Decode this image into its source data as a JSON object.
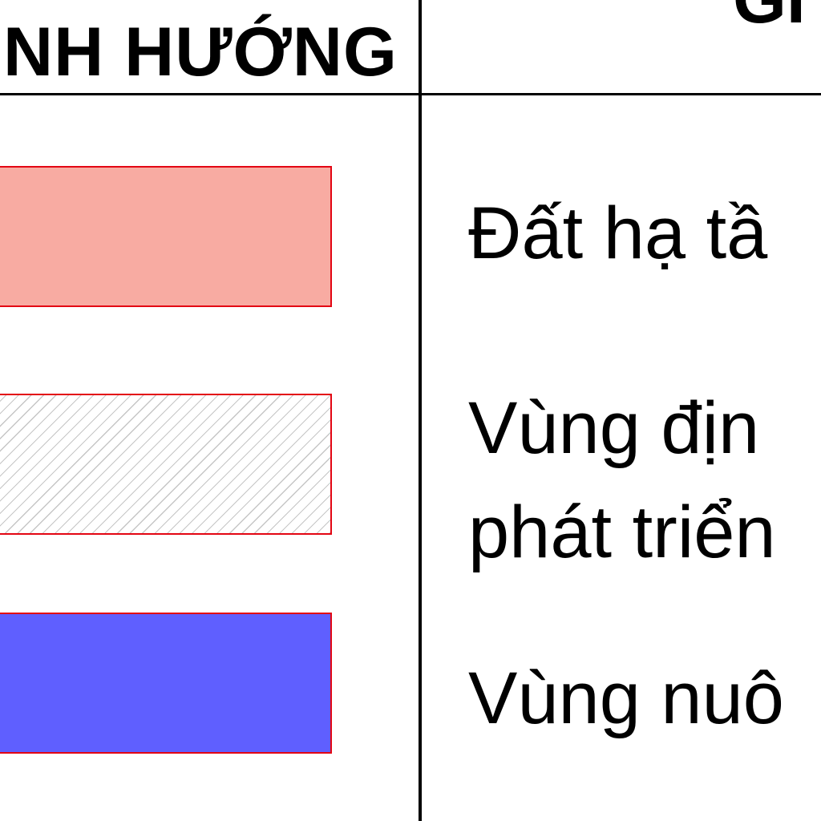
{
  "header": {
    "left_title": "NH HƯỚNG",
    "right_title": "GI"
  },
  "legend": {
    "items": [
      {
        "fill_color": "#f8aba2",
        "border_color": "#e30613",
        "pattern": "solid",
        "lines": [
          "Đất hạ tầ"
        ]
      },
      {
        "fill_color": "#ffffff",
        "border_color": "#e30613",
        "pattern": "diagonal-hatch",
        "lines": [
          "Vùng địn",
          "phát triển"
        ]
      },
      {
        "fill_color": "#5f5fff",
        "border_color": "#e30613",
        "pattern": "solid",
        "lines": [
          "Vùng nuô"
        ]
      }
    ]
  }
}
